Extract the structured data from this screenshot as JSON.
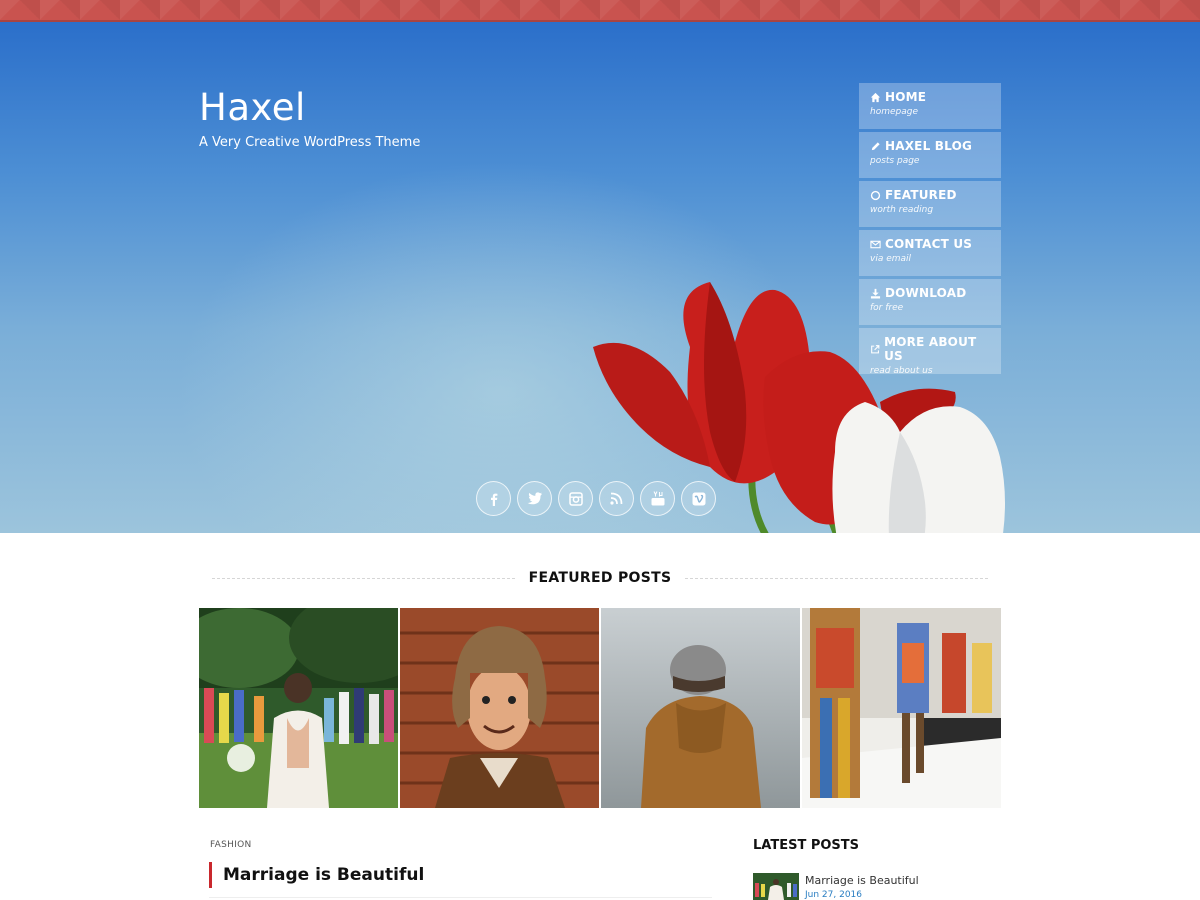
{
  "site": {
    "title": "Haxel",
    "tagline": "A Very Creative WordPress Theme"
  },
  "nav": {
    "items": [
      {
        "label": "HOME",
        "sub": "homepage",
        "icon": "home-icon"
      },
      {
        "label": "HAXEL BLOG",
        "sub": "posts page",
        "icon": "pencil-icon"
      },
      {
        "label": "FEATURED",
        "sub": "worth reading",
        "icon": "circle-icon"
      },
      {
        "label": "CONTACT US",
        "sub": "via email",
        "icon": "envelope-icon"
      },
      {
        "label": "DOWNLOAD",
        "sub": "for free",
        "icon": "download-icon"
      },
      {
        "label": "MORE ABOUT US",
        "sub": "read about us",
        "icon": "external-link-icon"
      }
    ]
  },
  "social": [
    "facebook-icon",
    "twitter-icon",
    "instagram-icon",
    "rss-icon",
    "youtube-icon",
    "vimeo-icon"
  ],
  "featured": {
    "heading": "FEATURED POSTS",
    "thumbnails": [
      "bride-in-lace-dress",
      "man-in-fur-hat",
      "person-in-knit-hat",
      "fashion-runway"
    ]
  },
  "post": {
    "category": "FASHION",
    "title": "Marriage is Beautiful"
  },
  "latest": {
    "heading": "LATEST POSTS",
    "items": [
      {
        "title": "Marriage is Beautiful",
        "date": "Jun 27, 2016"
      }
    ]
  },
  "colors": {
    "accent_red": "#c9282d",
    "top_bar": "#c9534f",
    "sky_top": "#2b6fca",
    "date_blue": "#2a7ec2"
  }
}
